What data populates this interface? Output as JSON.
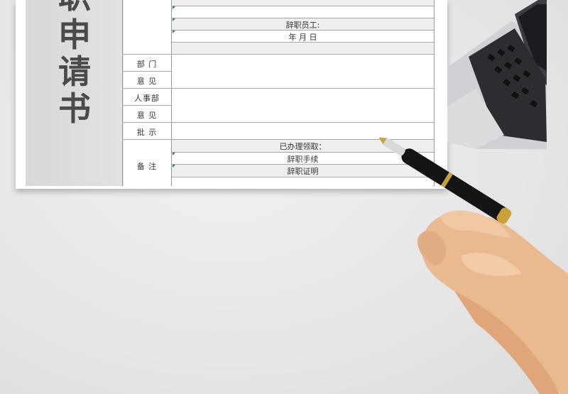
{
  "title_chars": [
    "职",
    "申",
    "请",
    "书"
  ],
  "labels": {
    "dept": "部 门",
    "opinion1": "意 见",
    "hr": "人事部",
    "opinion2": "意 见",
    "approval": "批 示",
    "remarks": "备 注"
  },
  "cells": {
    "employee": "辞职员工:",
    "date": "年 月 日",
    "processed": "已办理领取：",
    "procedures": "辞职手续",
    "certificate": "辞职证明"
  }
}
